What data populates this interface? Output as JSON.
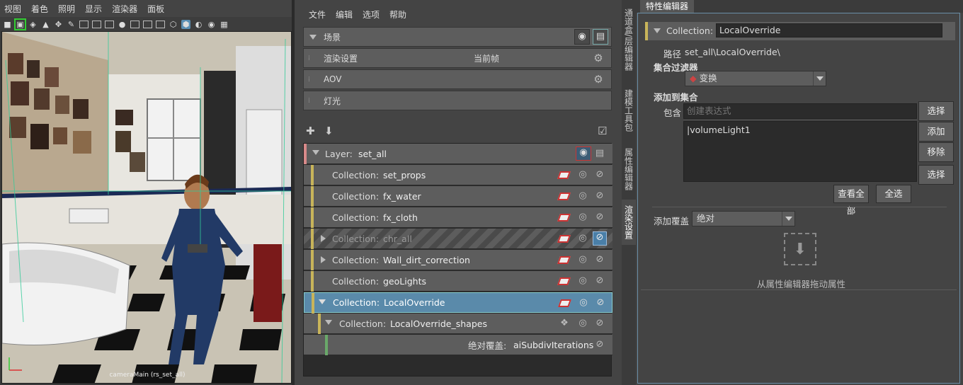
{
  "viewport": {
    "menu": [
      "视图",
      "着色",
      "照明",
      "显示",
      "渲染器",
      "面板"
    ],
    "camera_label": "cameraMain (rs_set_all)"
  },
  "render_setup": {
    "menu": [
      "文件",
      "编辑",
      "选项",
      "帮助"
    ],
    "scene_label": "场景",
    "render_settings_label": "渲染设置",
    "render_settings_value": "当前帧",
    "aov_label": "AOV",
    "lights_label": "灯光",
    "layer": {
      "prefix": "Layer:",
      "name": "set_all"
    },
    "collections": [
      {
        "prefix": "Collection:",
        "name": "set_props"
      },
      {
        "prefix": "Collection:",
        "name": "fx_water"
      },
      {
        "prefix": "Collection:",
        "name": "fx_cloth"
      },
      {
        "prefix": "Collection:",
        "name": "chr_all"
      },
      {
        "prefix": "Collection:",
        "name": "Wall_dirt_correction"
      },
      {
        "prefix": "Collection:",
        "name": "geoLights"
      },
      {
        "prefix": "Collection:",
        "name": "LocalOverride"
      },
      {
        "prefix": "Collection:",
        "name": "LocalOverride_shapes"
      }
    ],
    "override": {
      "label": "绝对覆盖:",
      "attr": "aiSubdivIterations"
    }
  },
  "vertical_tabs": [
    "通道盒/层编辑器",
    "建模工具包",
    "属性编辑器",
    "渲染设置"
  ],
  "attribute_editor": {
    "tab_title": "特性编辑器",
    "collection_label": "Collection:",
    "collection_value": "LocalOverride",
    "path_label": "路径",
    "path_value": "set_all\\LocalOverride\\",
    "filter_label": "集合过滤器",
    "filter_value": "变换",
    "add_to_collection_label": "添加到集合",
    "include_label": "包含",
    "include_placeholder": "创建表达式",
    "select_button": "选择",
    "list_item": "|volumeLight1",
    "add_button": "添加",
    "remove_button": "移除",
    "select_button2": "选择",
    "view_all_button": "查看全部",
    "select_all_button": "全选",
    "add_override_label": "添加覆盖",
    "add_override_value": "绝对",
    "drag_hint": "从属性编辑器拖动属性"
  },
  "colors": {
    "selected_row": "#5a8aaa",
    "layer_bar": "#d88a8a",
    "collection_bar": "#c8b45a",
    "override_bar": "#6aa86a",
    "panel_border": "#6a8fa8"
  }
}
